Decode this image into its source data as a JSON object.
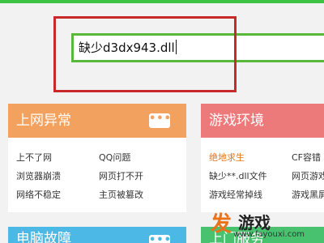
{
  "search": {
    "value": "缺少d3dx943.dll"
  },
  "panels": {
    "net": {
      "title": "上网异常",
      "more": "•••",
      "links": [
        "上不了网",
        "QQ问题",
        "浏览器崩溃",
        "网页打不开",
        "网络不稳定",
        "主页被篡改"
      ]
    },
    "game": {
      "title": "游戏环境",
      "links": [
        "绝地求生",
        "CF容错",
        "缺少**.dll文件",
        "网页游戏",
        "游戏经常掉线",
        "游戏黑屏"
      ]
    },
    "pc": {
      "title": "电脑故障",
      "more": "•••"
    },
    "fourth": {
      "title": "上门服务"
    }
  },
  "colors": {
    "accent_green": "#3ec243",
    "highlight_red": "#c8292a",
    "net_header": "#f2a15e",
    "game_header": "#ed7a7a",
    "pc_header": "#4cb8e6",
    "fourth_header": "#48c26e",
    "game_active_link": "#e8731a"
  },
  "watermark": {
    "mark": "发",
    "text": "游戏",
    "url": "www.fayouxi.com"
  }
}
